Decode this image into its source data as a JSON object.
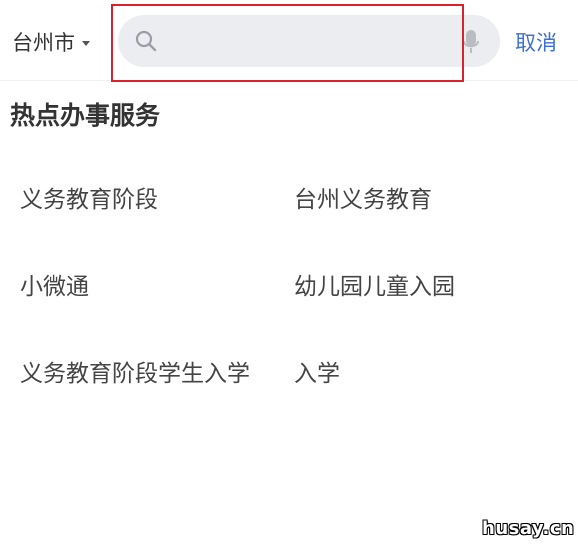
{
  "header": {
    "city": "台州市",
    "search": {
      "placeholder": "",
      "value": ""
    },
    "cancel_label": "取消"
  },
  "hot_services": {
    "title": "热点办事服务",
    "items": [
      "义务教育阶段",
      "台州义务教育",
      "小微通",
      "幼儿园儿童入园",
      "义务教育阶段学生入学",
      "入学"
    ]
  },
  "watermark": "husay.cn",
  "colors": {
    "accent": "#3d6fd3",
    "search_bg": "#ebedf0",
    "highlight": "#d9232c",
    "text_primary": "#333333"
  },
  "icons": [
    "chevron-down-icon",
    "search-icon",
    "microphone-icon"
  ]
}
